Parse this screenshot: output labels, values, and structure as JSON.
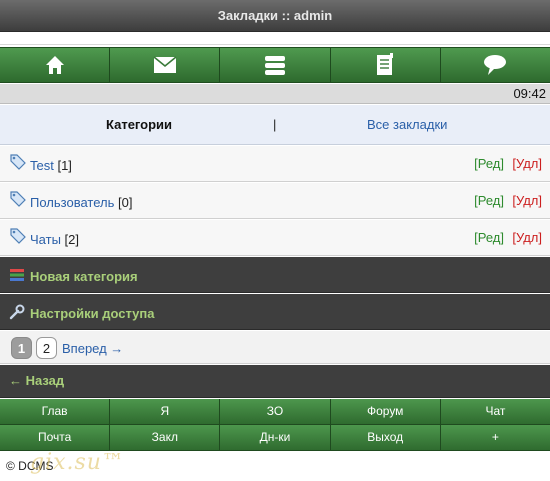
{
  "header": {
    "title": "Закладки :: admin"
  },
  "nav_icons": [
    "home-icon",
    "mail-icon",
    "stack-icon",
    "notepad-icon",
    "chat-bubble-icon"
  ],
  "status": {
    "time": "09:42"
  },
  "tabs": {
    "active": "Категории",
    "separator": "|",
    "other": "Все закладки"
  },
  "categories": [
    {
      "name": "Test",
      "count": "[1]",
      "edit": "[Ред]",
      "delete": "[Удл]"
    },
    {
      "name": "Пользователь",
      "count": "[0]",
      "edit": "[Ред]",
      "delete": "[Удл]"
    },
    {
      "name": "Чаты",
      "count": "[2]",
      "edit": "[Ред]",
      "delete": "[Удл]"
    }
  ],
  "actions": {
    "new_category": "Новая категория",
    "access_settings": "Настройки доступа"
  },
  "pager": {
    "current": "1",
    "page2": "2",
    "next": "Вперед →"
  },
  "back": "← Назад",
  "footer_nav": {
    "row1": [
      "Глав",
      "Я",
      "ЗО",
      "Форум",
      "Чат"
    ],
    "row2": [
      "Почта",
      "Закл",
      "Дн-ки",
      "Выход",
      "+"
    ]
  },
  "copyright": "© DCMS",
  "watermark": "gix.su™",
  "colors": {
    "green_nav": "#3f8a3f",
    "dark_bar": "#3e3e3e",
    "link": "#2a5fa8",
    "edit": "#2e8b2e",
    "delete": "#cc1f1f",
    "accent_text": "#a9cf7a"
  }
}
